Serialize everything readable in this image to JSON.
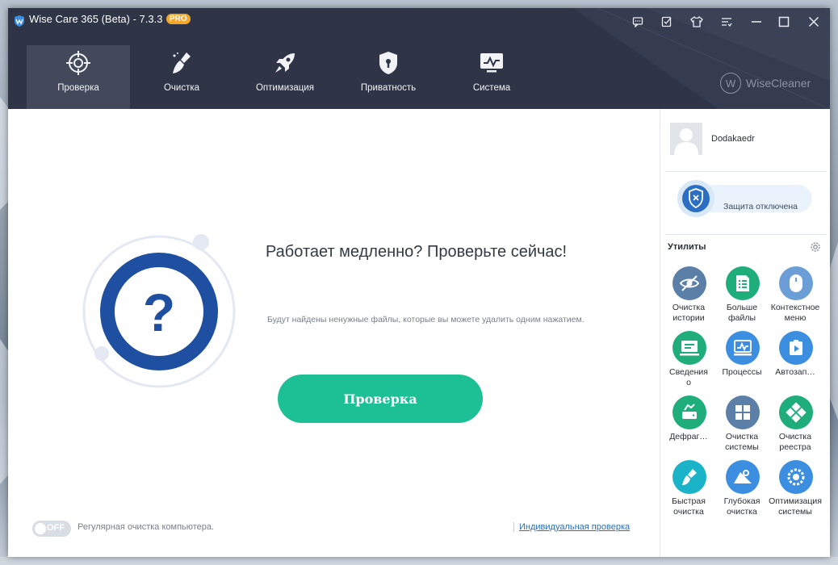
{
  "window": {
    "title": "Wise Care 365 (Beta) - 7.3.3",
    "badge": "PRO"
  },
  "titlebar_buttons": [
    {
      "name": "feedback-icon"
    },
    {
      "name": "notes-icon"
    },
    {
      "name": "skin-icon"
    },
    {
      "name": "menu-icon"
    },
    {
      "name": "minimize-icon"
    },
    {
      "name": "maximize-icon"
    },
    {
      "name": "close-icon"
    }
  ],
  "nav": {
    "tabs": [
      {
        "label": "Проверка",
        "icon": "crosshair-icon",
        "active": true
      },
      {
        "label": "Очистка",
        "icon": "broom-icon",
        "active": false
      },
      {
        "label": "Оптимизация",
        "icon": "rocket-icon",
        "active": false
      },
      {
        "label": "Приватность",
        "icon": "lock-shield-icon",
        "active": false
      },
      {
        "label": "Система",
        "icon": "monitor-icon",
        "active": false
      }
    ]
  },
  "brand": {
    "text": "WiseCleaner",
    "letter": "W"
  },
  "main": {
    "headline": "Работает медленно? Проверьте сейчас!",
    "subtext": "Будут найдены ненужные файлы, которые вы можете удалить одним нажатием.",
    "scan_button": "Проверка",
    "toggle_state": "OFF",
    "schedule_label": "Регулярная очистка компьютера.",
    "custom_scan_link": "Индивидуальная проверка",
    "ring_symbol": "?"
  },
  "sidebar": {
    "username": "Dodakaedr",
    "protection_status": "Защита отключена",
    "utilities_title": "Утилиты",
    "tools": [
      {
        "label": "Очистка\nистории",
        "icon": "eye-off-icon",
        "color": "#5b7fa6"
      },
      {
        "label": "Больше\nфайлы",
        "icon": "file-list-icon",
        "color": "#1fae7b"
      },
      {
        "label": "Контекстное\nменю",
        "icon": "mouse-icon",
        "color": "#6b9ed6"
      },
      {
        "label": "Сведения\nо",
        "icon": "computer-info-icon",
        "color": "#1fae7b"
      },
      {
        "label": "Процессы",
        "icon": "process-monitor-icon",
        "color": "#3c8fe0"
      },
      {
        "label": "Автозап…",
        "icon": "startup-icon",
        "color": "#3c8fe0"
      },
      {
        "label": "Дефраг…",
        "icon": "disk-defrag-icon",
        "color": "#1fae7b"
      },
      {
        "label": "Очистка\nсистемы",
        "icon": "windows-icon",
        "color": "#5b7fa6"
      },
      {
        "label": "Очистка\nреестра",
        "icon": "registry-icon",
        "color": "#1fae7b"
      },
      {
        "label": "Быстрая\nочистка",
        "icon": "quick-clean-icon",
        "color": "#1ab3c8"
      },
      {
        "label": "Глубокая\nочистка",
        "icon": "deep-clean-icon",
        "color": "#3c8fe0"
      },
      {
        "label": "Оптимизация\nсистемы",
        "icon": "optimize-gear-icon",
        "color": "#3c8fe0"
      }
    ]
  }
}
